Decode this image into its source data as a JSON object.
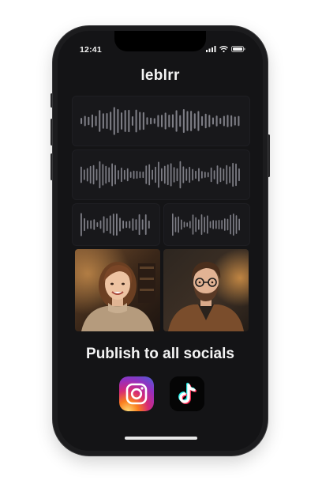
{
  "status_bar": {
    "time": "12:41",
    "signal_icon": "cellular-signal-icon",
    "wifi_icon": "wifi-icon",
    "battery_icon": "battery-icon"
  },
  "app": {
    "title": "leblrr"
  },
  "audio_tracks": [
    {
      "name": "waveform-1",
      "seed": 3,
      "bars": 44
    },
    {
      "name": "waveform-2",
      "seed": 7,
      "bars": 52
    },
    {
      "name": "waveform-3",
      "seed": 11,
      "bars": 22
    },
    {
      "name": "waveform-4",
      "seed": 5,
      "bars": 24
    }
  ],
  "video_feeds": [
    {
      "name": "woman-video",
      "description_icon": "person-woman-icon"
    },
    {
      "name": "man-video",
      "description_icon": "person-man-icon"
    }
  ],
  "publish": {
    "text": "Publish to all socials"
  },
  "socials": [
    {
      "name": "Instagram",
      "icon": "instagram-icon"
    },
    {
      "name": "TikTok",
      "icon": "tiktok-icon"
    }
  ],
  "colors": {
    "screen_bg": "#141416",
    "waveform": "#7d7d85",
    "instagram_gradient": [
      "#feda75",
      "#fa7e1e",
      "#d62976",
      "#962fbf",
      "#4f5bd5"
    ],
    "tiktok_cyan": "#25f4ee",
    "tiktok_red": "#fe2c55"
  }
}
